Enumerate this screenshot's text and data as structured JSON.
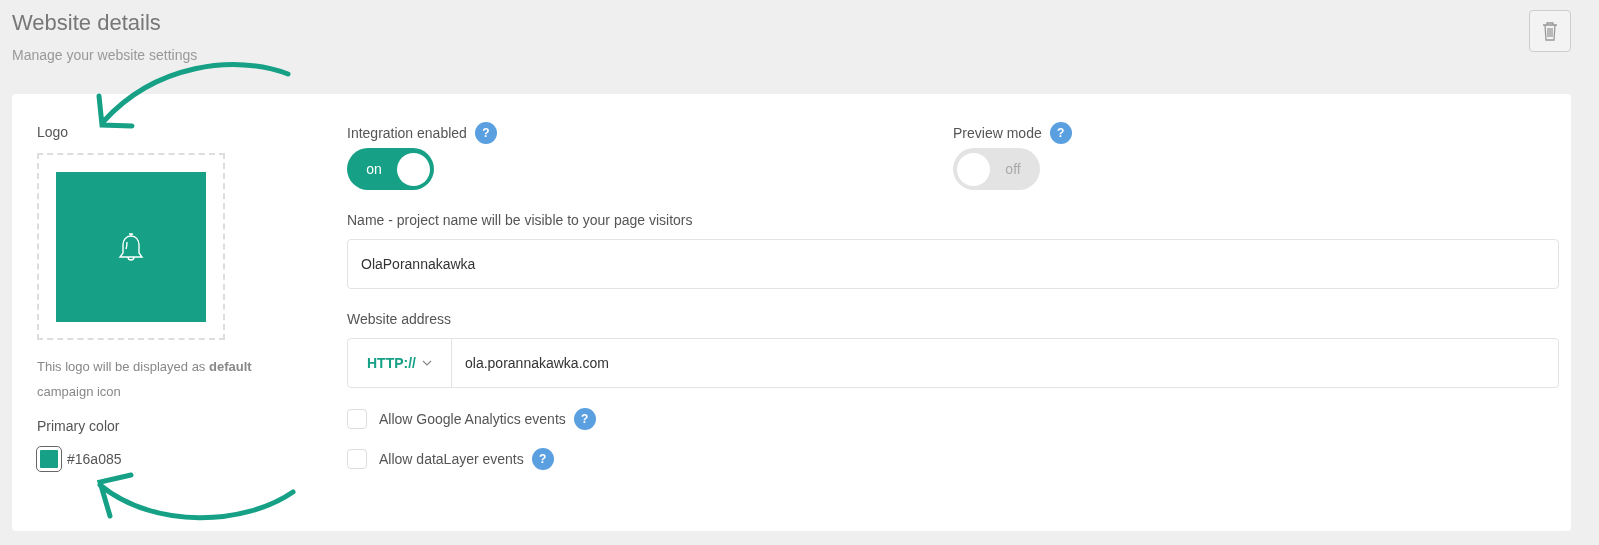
{
  "header": {
    "title": "Website details",
    "subtitle": "Manage your website settings"
  },
  "logo": {
    "label": "Logo",
    "note": "This logo will be displayed as **default** campaign icon"
  },
  "primary_color": {
    "label": "Primary color",
    "color": "#16a085",
    "value": "#16a085"
  },
  "toggles": [
    {
      "label": "Integration enabled",
      "help": "?",
      "on": true,
      "state_text": "on"
    },
    {
      "label": "Preview mode",
      "help": "?",
      "on": false,
      "state_text": "off"
    }
  ],
  "name_field": {
    "label": "Name - project name will be visible to your page visitors",
    "value": "OlaPorannakawka"
  },
  "address_field": {
    "label": "Website address",
    "protocol": "HTTP://",
    "value": "ola.porannakawka.com"
  },
  "checkboxes": [
    {
      "label": "Allow Google Analytics events",
      "help": "?",
      "checked": false
    },
    {
      "label": "Allow dataLayer events",
      "help": "?",
      "checked": false
    }
  ]
}
